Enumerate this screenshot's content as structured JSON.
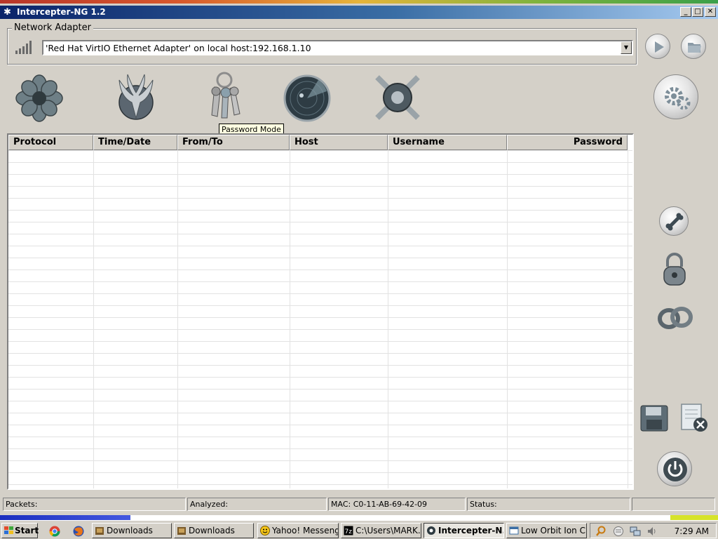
{
  "window": {
    "title": "Intercepter-NG 1.2",
    "controls": {
      "minimize": "_",
      "maximize": "□",
      "close": "✕"
    }
  },
  "adapter": {
    "group_label": "Network Adapter",
    "selected": "'Red Hat VirtIO Ethernet Adapter' on local host:192.168.1.10"
  },
  "tooltip": "Password Mode",
  "table": {
    "columns": [
      "Protocol",
      "Time/Date",
      "From/To",
      "Host",
      "Username",
      "Password"
    ]
  },
  "status": {
    "packets": "Packets:",
    "analyzed": "Analyzed:",
    "mac": "MAC: C0-11-AB-69-42-09",
    "status": "Status:"
  },
  "taskbar": {
    "start": "Start",
    "items": [
      "Downloads",
      "Downloads",
      "Yahoo! Messenger",
      "C:\\Users\\MARK...",
      "Intercepter-N...",
      "Low Orbit Ion C..."
    ],
    "clock": "7:29 AM"
  }
}
